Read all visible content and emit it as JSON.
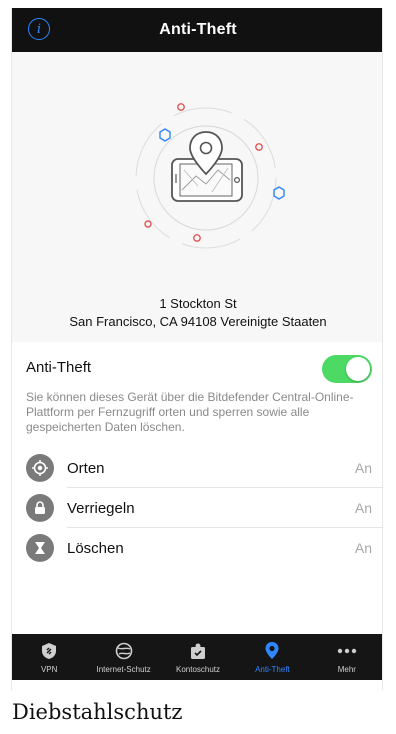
{
  "navbar": {
    "title": "Anti-Theft",
    "info_icon": "info-icon",
    "info_glyph": "i"
  },
  "hero": {
    "address_line1": "1 Stockton St",
    "address_line2": "San Francisco, CA  94108 Vereinigte Staaten",
    "illustration": "phone-with-map-pin-icon"
  },
  "anti_theft": {
    "label": "Anti-Theft",
    "toggle_on": true,
    "toggle_color": "#4cd964",
    "description": "Sie können dieses Gerät über die Bitdefender Central-Online-Plattform per Fernzugriff orten und sperren sowie alle gespeicherten Daten löschen."
  },
  "features": [
    {
      "label": "Orten",
      "state": "An",
      "icon": "locate-icon"
    },
    {
      "label": "Verriegeln",
      "state": "An",
      "icon": "lock-icon"
    },
    {
      "label": "Löschen",
      "state": "An",
      "icon": "wipe-icon"
    }
  ],
  "tabs": [
    {
      "label": "VPN",
      "icon": "vpn-shield-icon",
      "active": false
    },
    {
      "label": "Internet-Schutz",
      "icon": "globe-icon",
      "active": false
    },
    {
      "label": "Kontoschutz",
      "icon": "account-icon",
      "active": false
    },
    {
      "label": "Anti-Theft",
      "icon": "map-pin-icon",
      "active": true
    },
    {
      "label": "Mehr",
      "icon": "more-dots-icon",
      "active": false
    }
  ],
  "colors": {
    "accent": "#2f86ff",
    "navbar": "#111111",
    "tabbar": "#151515",
    "hero_bg": "#f7f7f7"
  },
  "caption": "Diebstahlschutz"
}
